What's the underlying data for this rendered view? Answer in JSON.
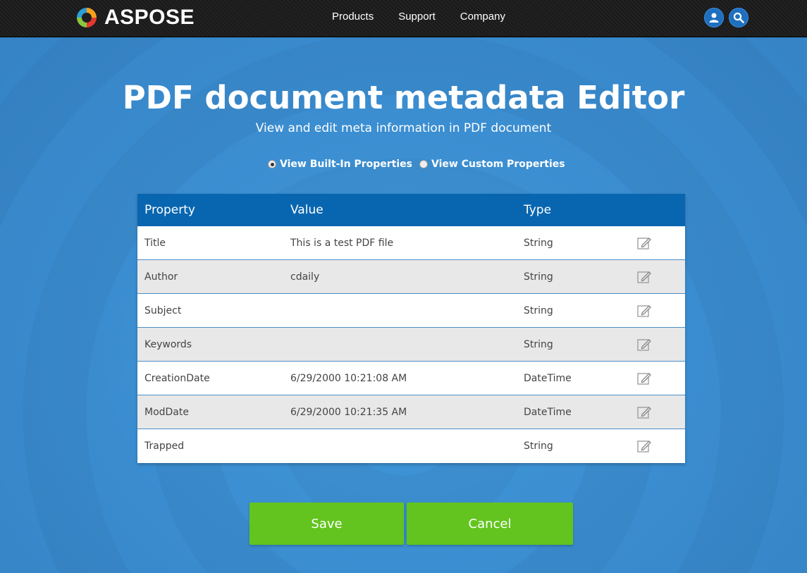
{
  "header": {
    "brand": "ASPOSE",
    "nav": [
      "Products",
      "Support",
      "Company"
    ],
    "icons": [
      "user-icon",
      "search-icon"
    ]
  },
  "page": {
    "title": "PDF document metadata Editor",
    "subtitle": "View and edit meta information in PDF document"
  },
  "view_toggle": {
    "options": [
      "View Built-In Properties",
      "View Custom Properties"
    ],
    "selected": "View Built-In Properties"
  },
  "table": {
    "headers": [
      "Property",
      "Value",
      "Type"
    ],
    "rows": [
      {
        "property": "Title",
        "value": "This is a test PDF file",
        "type": "String"
      },
      {
        "property": "Author",
        "value": "cdaily",
        "type": "String"
      },
      {
        "property": "Subject",
        "value": "",
        "type": "String"
      },
      {
        "property": "Keywords",
        "value": "",
        "type": "String"
      },
      {
        "property": "CreationDate",
        "value": "6/29/2000 10:21:08 AM",
        "type": "DateTime"
      },
      {
        "property": "ModDate",
        "value": "6/29/2000 10:21:35 AM",
        "type": "DateTime"
      },
      {
        "property": "Trapped",
        "value": "",
        "type": "String"
      }
    ],
    "row_action_icon": "pencil-edit-icon"
  },
  "actions": {
    "save_label": "Save",
    "cancel_label": "Cancel"
  },
  "colors": {
    "accent": "#0866b0",
    "button": "#63c41f",
    "background": "#3a8fd1"
  }
}
